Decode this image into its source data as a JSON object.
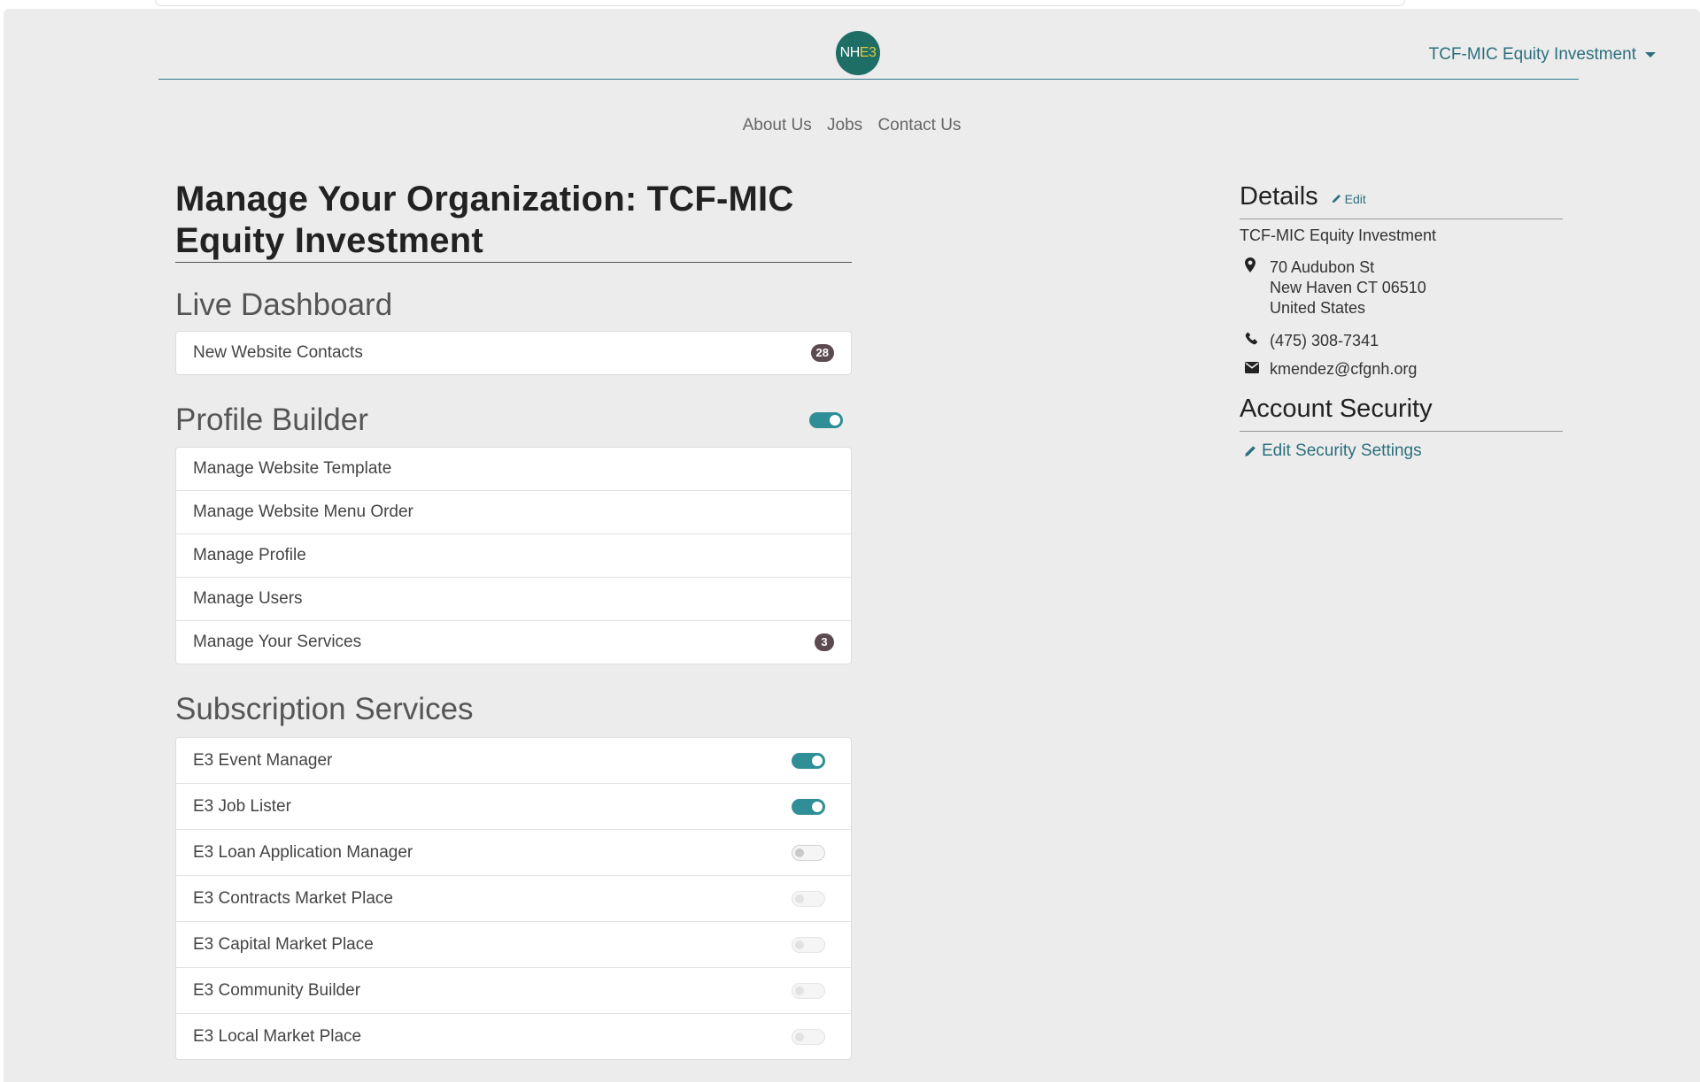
{
  "header": {
    "logo": {
      "part1": "NH",
      "part2": "E3"
    },
    "org_dropdown": "TCF-MIC Equity Investment"
  },
  "nav": [
    "About Us",
    "Jobs",
    "Contact Us"
  ],
  "page_title": "Manage Your Organization: TCF-MIC Equity Investment",
  "live_dashboard": {
    "title": "Live Dashboard",
    "items": [
      {
        "label": "New Website Contacts",
        "badge": "28"
      }
    ]
  },
  "profile_builder": {
    "title": "Profile Builder",
    "toggle_on": true,
    "items": [
      {
        "label": "Manage Website Template"
      },
      {
        "label": "Manage Website Menu Order"
      },
      {
        "label": "Manage Profile"
      },
      {
        "label": "Manage Users"
      },
      {
        "label": "Manage Your Services",
        "badge": "3"
      }
    ]
  },
  "subscription_services": {
    "title": "Subscription Services",
    "items": [
      {
        "label": "E3 Event Manager",
        "state": "on"
      },
      {
        "label": "E3 Job Lister",
        "state": "on"
      },
      {
        "label": "E3 Loan Application Manager",
        "state": "off"
      },
      {
        "label": "E3 Contracts Market Place",
        "state": "off-disabled"
      },
      {
        "label": "E3 Capital Market Place",
        "state": "off-disabled"
      },
      {
        "label": "E3 Community Builder",
        "state": "off-disabled"
      },
      {
        "label": "E3 Local Market Place",
        "state": "off-disabled"
      }
    ]
  },
  "details": {
    "title": "Details",
    "edit_label": "Edit",
    "org_name": "TCF-MIC Equity Investment",
    "address": [
      "70 Audubon St",
      "New Haven CT 06510",
      "United States"
    ],
    "phone": "(475) 308-7341",
    "email": "kmendez@cfgnh.org"
  },
  "account_security": {
    "title": "Account Security",
    "link": "Edit Security Settings"
  },
  "colors": {
    "accent": "#2f8e96",
    "link": "#2b6f7d",
    "badge": "#5b4a50",
    "logo_bg": "#1e6e66"
  }
}
